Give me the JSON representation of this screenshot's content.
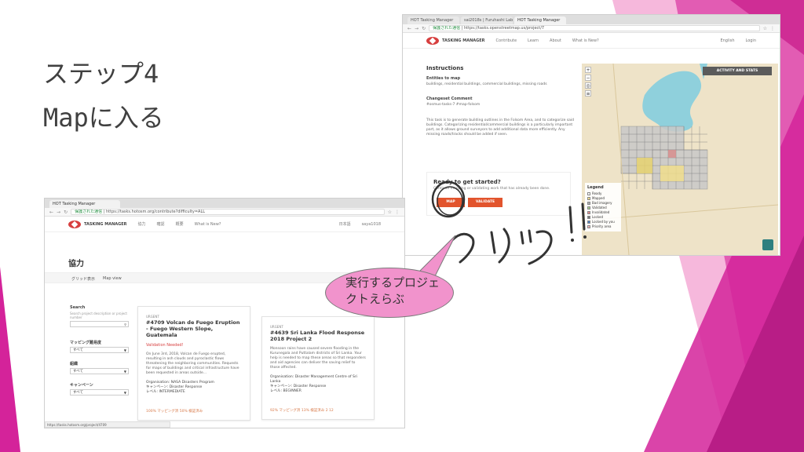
{
  "slide": {
    "title_line1": "ステップ4",
    "title_line2": "Mapに入る",
    "callout": "実行するプロジェクトえらぶ",
    "handwriting": "クリック!!"
  },
  "colors": {
    "magenta": "#d4239a",
    "pink": "#f193cc",
    "brand_red": "#d73f3f",
    "orange_button": "#e2542d"
  },
  "front_window": {
    "tab_title": "HOT Tasking Manager",
    "url_secure": "保護された通信",
    "url": "https://tasks.hotosm.org/contribute?difficulty=ALL",
    "header": {
      "logo_text": "TASKING MANAGER",
      "nav": [
        "協力",
        "確認",
        "概要",
        "What is New?"
      ],
      "language": "日本語",
      "user": "saya1018"
    },
    "page_title": "協力",
    "view_tabs": [
      "グリッド表示",
      "Map view"
    ],
    "filters": {
      "search_label": "Search",
      "search_help": "Search project description or project number",
      "mapping_label": "マッピング難易度",
      "mapping_value": "すべて",
      "org_label": "組織",
      "org_value": "すべて",
      "campaign_label": "キャンペーン",
      "campaign_value": "すべて"
    },
    "cards": [
      {
        "urgency": "URGENT",
        "title": "#4709 Volcan de Fuego Eruption - Fuego Western Slope, Guatemala",
        "validation": "Validation Needed!",
        "desc": "On June 3rd, 2018, Volcan de Fuego erupted, resulting in ash clouds and pyroclastic flows threatening the neighboring communities. Requests for maps of buildings and critical infrastructure have been requested in areas outside...",
        "org": "Organisation: NASA Disasters Program",
        "campaign": "キャンペーン: Disaster Response",
        "level": "レベル: INTERMEDIATE",
        "footer": "100% マッピング済   50% 検証済み"
      },
      {
        "urgency": "URGENT",
        "title": "#4639 Sri Lanka Flood Response 2018 Project 2",
        "desc": "Monsoon rains have caused severe flooding in the Kurunegala and Puttalam districts of Sri Lanka. Your help is needed to map these areas so that responders and aid agencies can deliver the saving relief to those affected.",
        "org": "Organisation: Disaster Management Centre of Sri Lanka",
        "campaign": "キャンペーン: Disaster Response",
        "level": "レベル: BEGINNER",
        "footer": "92% マッピング済   13% 検証済み   2 12"
      }
    ],
    "status_url": "https://tasks.hotosm.org/project/4709"
  },
  "right_window": {
    "tabs": [
      "HOT Tasking Manager",
      "sai2018s | Furuhashi Lab",
      "HOT Tasking Manager"
    ],
    "url_secure": "保護された通信",
    "url": "https://tasks.openstreetmap.us/project/7",
    "header": {
      "logo_text": "TASKING MANAGER",
      "nav": [
        "Contribute",
        "Learn",
        "About",
        "What is New?"
      ],
      "language": "English",
      "login": "Login"
    },
    "instructions": {
      "heading": "Instructions",
      "entities_label": "Entities to map",
      "entities_value": "buildings, residential buildings, commercial buildings, missing roads",
      "changeset_label": "Changeset Comment",
      "changeset_value": "#osmus-tasks-7 #map-folsom",
      "body": "This task is to generate building outlines in the Folsom Area, and to categorize said buildings. Categorizing residential/commercial buildings is a particularly important part, as it allows ground surveyors to add additional data more efficiently. Any missing roads/tracks should be added if seen."
    },
    "ready": {
      "title": "Ready to get started?",
      "subtitle": "Continue mapping or validating work that has already been done.",
      "map_button": "MAP",
      "validate_button": "VALIDATE"
    },
    "map": {
      "activity_button": "ACTIVITY AND STATS",
      "legend_title": "Legend",
      "legend_items": [
        "Ready",
        "Mapped",
        "Bad imagery",
        "Validated",
        "Invalidated",
        "Locked",
        "Locked by you",
        "Priority area"
      ],
      "zoom_in": "+",
      "zoom_out": "−"
    }
  }
}
